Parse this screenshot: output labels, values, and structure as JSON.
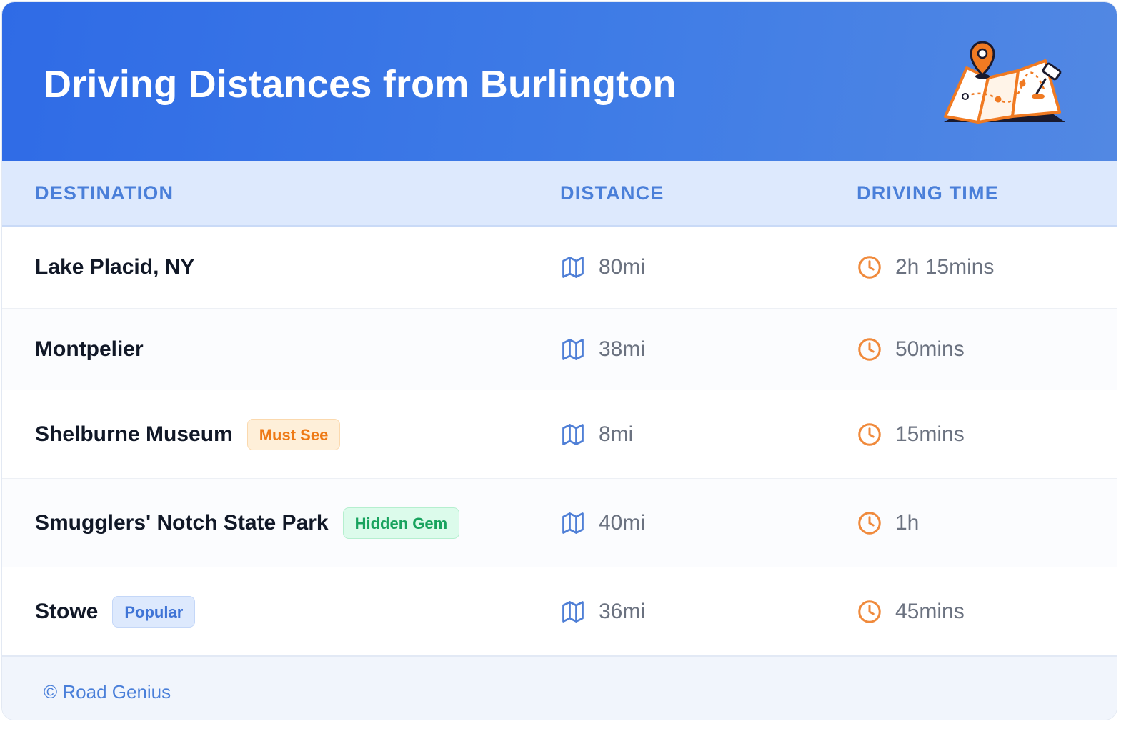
{
  "header": {
    "title": "Driving Distances from Burlington",
    "illustration_icon": "folded-map-with-pin-icon"
  },
  "table": {
    "columns": [
      "DESTINATION",
      "DISTANCE",
      "DRIVING TIME"
    ],
    "distance_icon": "map-icon",
    "time_icon": "clock-icon",
    "rows": [
      {
        "destination": "Lake Placid, NY",
        "badge": "",
        "distance": "80mi",
        "time": "2h 15mins"
      },
      {
        "destination": "Montpelier",
        "badge": "",
        "distance": "38mi",
        "time": "50mins"
      },
      {
        "destination": "Shelburne Museum",
        "badge": "Must See",
        "distance": "8mi",
        "time": "15mins"
      },
      {
        "destination": "Smugglers' Notch State Park",
        "badge": "Hidden Gem",
        "distance": "40mi",
        "time": "1h"
      },
      {
        "destination": "Stowe",
        "badge": "Popular",
        "distance": "36mi",
        "time": "45mins"
      }
    ]
  },
  "footer": {
    "text": "© Road Genius"
  },
  "colors": {
    "header_start": "#2f6be6",
    "header_end": "#5288e3",
    "column_header_text": "#4a7fd9",
    "badge_must_see": "#ee7a16",
    "badge_hidden_gem": "#18a35e",
    "badge_popular": "#3f74d6",
    "distance_icon": "#4f7fd6",
    "time_icon": "#f08a3c"
  }
}
